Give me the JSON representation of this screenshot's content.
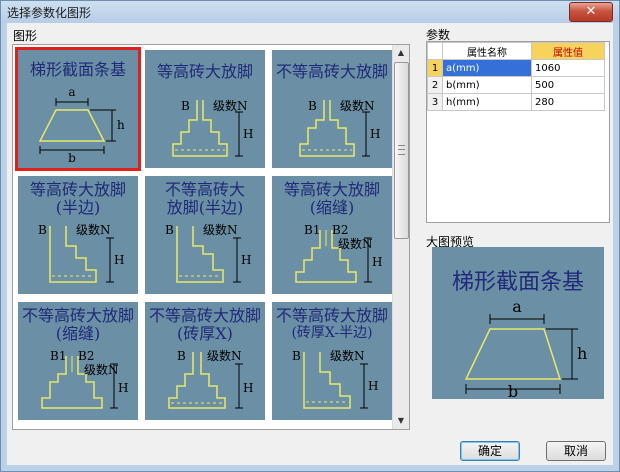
{
  "window": {
    "title": "选择参数化图形",
    "close_glyph": "✕"
  },
  "sections": {
    "shapes": "图形",
    "params": "参数",
    "preview": "大图预览"
  },
  "shapes": [
    {
      "title": "梯形截面条基",
      "selected": true,
      "labels": {
        "a": "a",
        "b": "b",
        "h": "h"
      }
    },
    {
      "title": "等高砖大放脚",
      "labels": {
        "b": "B",
        "n": "级数N",
        "h": "H"
      }
    },
    {
      "title": "不等高砖大放脚",
      "labels": {
        "b": "B",
        "n": "级数N",
        "h": "H"
      }
    },
    {
      "title_lines": [
        "等高砖大放脚",
        "(半边)"
      ],
      "labels": {
        "b": "B",
        "n": "级数N",
        "h": "H"
      }
    },
    {
      "title_lines": [
        "不等高砖大",
        "放脚(半边)"
      ],
      "labels": {
        "b": "B",
        "n": "级数N",
        "h": "H"
      }
    },
    {
      "title_lines": [
        "等高砖大放脚",
        "(缩缝)"
      ],
      "labels": {
        "b1": "B1",
        "b2": "B2",
        "n": "级数N",
        "h": "H"
      }
    },
    {
      "title_lines": [
        "不等高砖大放脚",
        "(缩缝)"
      ],
      "labels": {
        "b1": "B1",
        "b2": "B2",
        "n": "级数N",
        "h": "H"
      }
    },
    {
      "title_lines": [
        "不等高砖大放脚",
        "(砖厚X)"
      ],
      "labels": {
        "b": "B",
        "n": "级数N",
        "h": "H"
      }
    },
    {
      "title_lines": [
        "不等高砖大放脚",
        "(砖厚X-半边)"
      ],
      "labels": {
        "b": "B",
        "n": "级数N",
        "h": "H"
      }
    }
  ],
  "params": {
    "headers": {
      "name": "属性名称",
      "value": "属性值"
    },
    "rows": [
      {
        "idx": "1",
        "name": "a(mm)",
        "value": "1060",
        "selected": true
      },
      {
        "idx": "2",
        "name": "b(mm)",
        "value": "500"
      },
      {
        "idx": "3",
        "name": "h(mm)",
        "value": "280"
      }
    ]
  },
  "preview": {
    "title": "梯形截面条基",
    "labels": {
      "a": "a",
      "b": "b",
      "h": "h"
    }
  },
  "buttons": {
    "ok": "确定",
    "cancel": "取消"
  },
  "colors": {
    "tile_bg": "#6b8fa4",
    "selection_border": "#e0201c",
    "shape_line": "#e8e86a",
    "header_highlight": "#f7d35d",
    "row_highlight": "#3470d8"
  }
}
